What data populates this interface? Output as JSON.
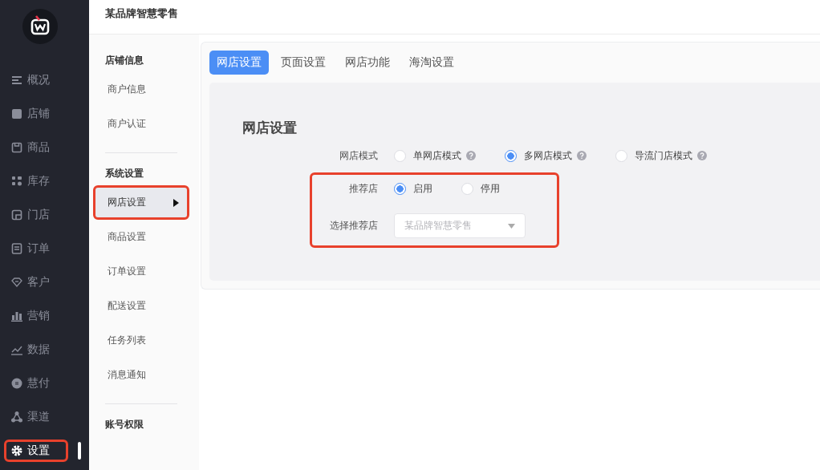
{
  "sidebar": {
    "items": [
      {
        "label": "概况",
        "selected": false,
        "highlighted": false
      },
      {
        "label": "店铺",
        "selected": false,
        "highlighted": false
      },
      {
        "label": "商品",
        "selected": false,
        "highlighted": false
      },
      {
        "label": "库存",
        "selected": false,
        "highlighted": false
      },
      {
        "label": "门店",
        "selected": false,
        "highlighted": false
      },
      {
        "label": "订单",
        "selected": false,
        "highlighted": false
      },
      {
        "label": "客户",
        "selected": false,
        "highlighted": false
      },
      {
        "label": "营销",
        "selected": false,
        "highlighted": false
      },
      {
        "label": "数据",
        "selected": false,
        "highlighted": false
      },
      {
        "label": "慧付",
        "selected": false,
        "highlighted": false
      },
      {
        "label": "渠道",
        "selected": false,
        "highlighted": false
      },
      {
        "label": "设置",
        "selected": true,
        "highlighted": true
      }
    ]
  },
  "header": {
    "title": "某品牌智慧零售"
  },
  "submenu": {
    "groups": [
      {
        "title": "店铺信息",
        "items": [
          {
            "label": "商户信息",
            "selected": false,
            "highlighted": false
          },
          {
            "label": "商户认证",
            "selected": false,
            "highlighted": false
          }
        ]
      },
      {
        "title": "系统设置",
        "items": [
          {
            "label": "网店设置",
            "selected": true,
            "highlighted": true
          },
          {
            "label": "商品设置",
            "selected": false,
            "highlighted": false
          },
          {
            "label": "订单设置",
            "selected": false,
            "highlighted": false
          },
          {
            "label": "配送设置",
            "selected": false,
            "highlighted": false
          },
          {
            "label": "任务列表",
            "selected": false,
            "highlighted": false
          },
          {
            "label": "消息通知",
            "selected": false,
            "highlighted": false
          }
        ]
      },
      {
        "title": "账号权限"
      }
    ]
  },
  "tabs": [
    {
      "label": "网店设置",
      "selected": true
    },
    {
      "label": "页面设置",
      "selected": false
    },
    {
      "label": "网店功能",
      "selected": false
    },
    {
      "label": "海淘设置",
      "selected": false
    }
  ],
  "form": {
    "title": "网店设置",
    "mode": {
      "label": "网店模式",
      "options": [
        {
          "label": "单网店模式",
          "selected": false,
          "help": true
        },
        {
          "label": "多网店模式",
          "selected": true,
          "help": true
        },
        {
          "label": "导流门店模式",
          "selected": false,
          "help": true
        }
      ]
    },
    "recommend_group": {
      "highlighted": true,
      "recommend": {
        "label": "推荐店",
        "options": [
          {
            "label": "启用",
            "selected": true
          },
          {
            "label": "停用",
            "selected": false
          }
        ]
      },
      "select_store": {
        "label": "选择推荐店",
        "placeholder": "某品牌智慧零售"
      }
    }
  }
}
